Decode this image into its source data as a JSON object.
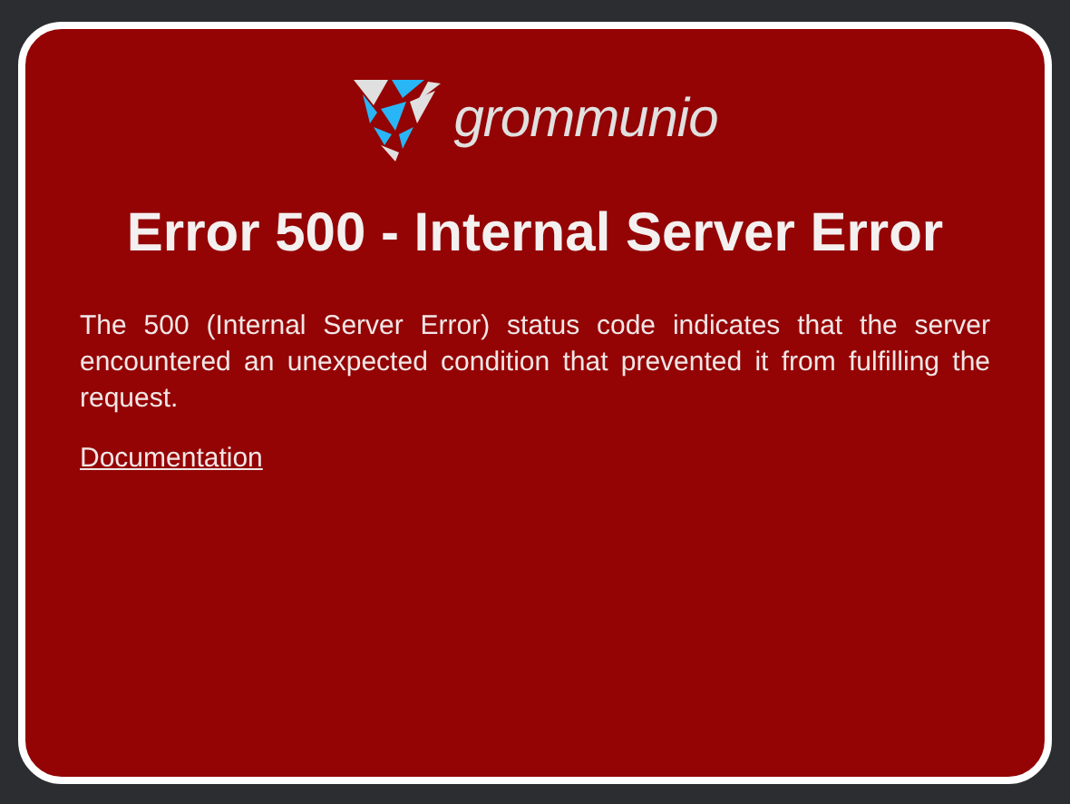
{
  "logo": {
    "wordmark": "grommunio"
  },
  "title": "Error 500 - Internal Server Error",
  "message": "The 500 (Internal Server Error) status code indicates that the server encountered an unexpected condition that prevented it from fulfilling the request.",
  "link": "Documentation"
}
